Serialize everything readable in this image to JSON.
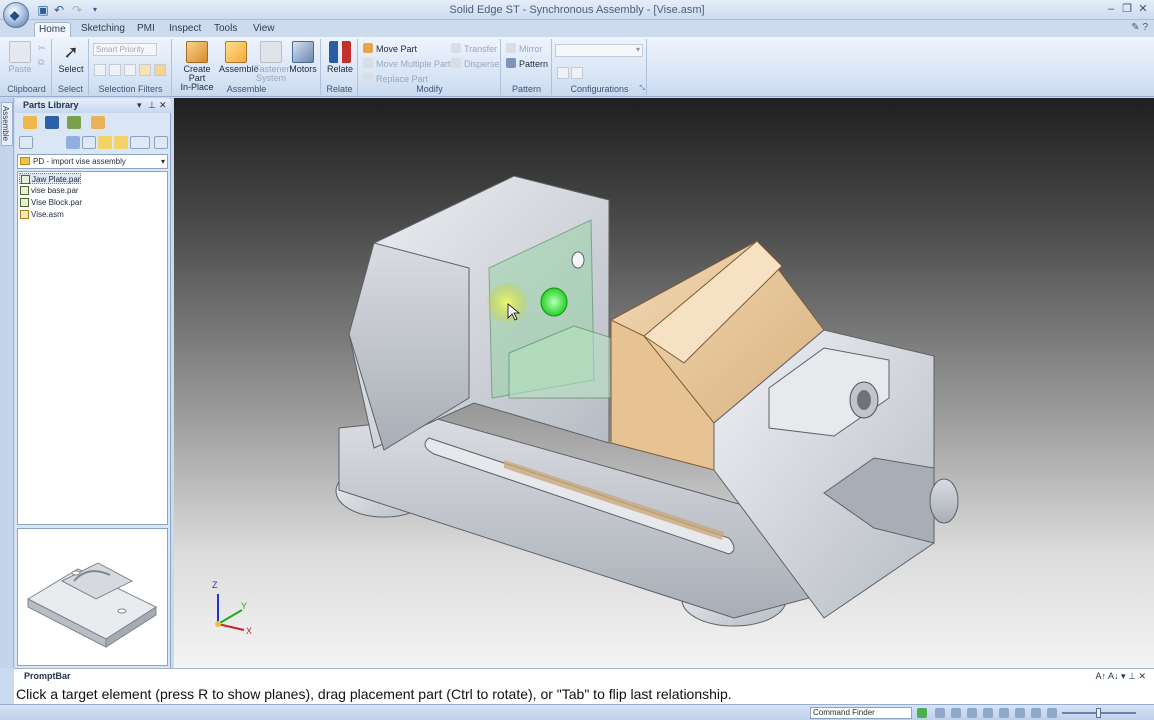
{
  "title": "Solid Edge ST - Synchronous Assembly - [Vise.asm]",
  "tabs": [
    "Home",
    "Sketching",
    "PMI",
    "Inspect",
    "Tools",
    "View"
  ],
  "ribbon": {
    "clipboard": {
      "label": "Clipboard",
      "paste": "Paste"
    },
    "select": {
      "label": "Select",
      "select": "Select"
    },
    "selection_filters": {
      "label": "Selection Filters",
      "smart_priority": "Smart Priority"
    },
    "assemble": {
      "label": "Assemble",
      "create_part": "Create Part",
      "in_place": "In-Place",
      "assemble": "Assemble",
      "fastener": "Fastener",
      "system": "System",
      "motors": "Motors"
    },
    "relate": {
      "label": "Relate",
      "relate": "Relate"
    },
    "modify": {
      "label": "Modify",
      "move_part": "Move Part",
      "move_multiple": "Move Multiple Parts",
      "replace_part": "Replace Part",
      "transfer": "Transfer",
      "disperse": "Disperse"
    },
    "pattern": {
      "label": "Pattern",
      "mirror": "Mirror",
      "pattern": "Pattern"
    },
    "configurations": {
      "label": "Configurations"
    }
  },
  "dock_tab": "Assemble",
  "parts_library": {
    "title": "Parts Library",
    "folder": "PD - import vise assembly",
    "items": [
      "Jaw Plate.par",
      "vise base.par",
      "Vise Block.par",
      "Vise.asm"
    ],
    "selected_index": 0
  },
  "triad": {
    "x": "X",
    "y": "Y",
    "z": "Z"
  },
  "promptbar": {
    "title": "PromptBar",
    "text": "Click a target element (press R to show planes), drag placement part (Ctrl to rotate), or \"Tab\" to flip last relationship."
  },
  "statusbar": {
    "command_finder": "Command Finder"
  },
  "colors": {
    "ribbon": "#d7e4f5",
    "part_grey": "#c9ced6",
    "jaw_orange": "#e8c9a0",
    "highlight_green": "#3cff3c"
  }
}
